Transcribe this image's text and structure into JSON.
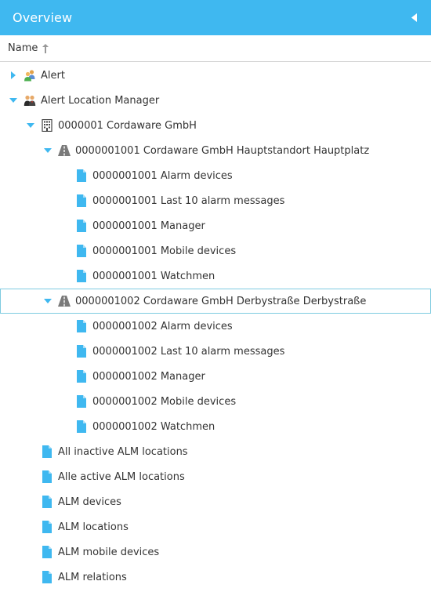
{
  "header": {
    "title": "Overview"
  },
  "columns": {
    "name": "Name"
  },
  "tree": [
    {
      "label": "Alert",
      "level": 0,
      "toggle": "collapsed",
      "icon": "users-icon"
    },
    {
      "label": "Alert Location Manager",
      "level": 0,
      "toggle": "expanded",
      "icon": "users-dark-icon"
    },
    {
      "label": "0000001 Cordaware GmbH",
      "level": 1,
      "toggle": "expanded",
      "icon": "building-icon"
    },
    {
      "label": "0000001001 Cordaware GmbH Hauptstandort Hauptplatz",
      "level": 2,
      "toggle": "expanded",
      "icon": "road-icon"
    },
    {
      "label": "0000001001 Alarm devices",
      "level": 3,
      "toggle": "none",
      "icon": "document-icon"
    },
    {
      "label": "0000001001 Last 10 alarm messages",
      "level": 3,
      "toggle": "none",
      "icon": "document-icon"
    },
    {
      "label": "0000001001 Manager",
      "level": 3,
      "toggle": "none",
      "icon": "document-icon"
    },
    {
      "label": "0000001001 Mobile devices",
      "level": 3,
      "toggle": "none",
      "icon": "document-icon"
    },
    {
      "label": "0000001001 Watchmen",
      "level": 3,
      "toggle": "none",
      "icon": "document-icon"
    },
    {
      "label": "0000001002 Cordaware GmbH Derbystraße Derbystraße",
      "level": 2,
      "toggle": "expanded",
      "icon": "road-icon",
      "selected": true
    },
    {
      "label": "0000001002 Alarm devices",
      "level": 3,
      "toggle": "none",
      "icon": "document-icon"
    },
    {
      "label": "0000001002 Last 10 alarm messages",
      "level": 3,
      "toggle": "none",
      "icon": "document-icon"
    },
    {
      "label": "0000001002 Manager",
      "level": 3,
      "toggle": "none",
      "icon": "document-icon"
    },
    {
      "label": "0000001002 Mobile devices",
      "level": 3,
      "toggle": "none",
      "icon": "document-icon"
    },
    {
      "label": "0000001002 Watchmen",
      "level": 3,
      "toggle": "none",
      "icon": "document-icon"
    },
    {
      "label": "All inactive ALM locations",
      "level": 1,
      "toggle": "none",
      "icon": "document-icon"
    },
    {
      "label": "Alle active ALM locations",
      "level": 1,
      "toggle": "none",
      "icon": "document-icon"
    },
    {
      "label": "ALM devices",
      "level": 1,
      "toggle": "none",
      "icon": "document-icon"
    },
    {
      "label": "ALM locations",
      "level": 1,
      "toggle": "none",
      "icon": "document-icon"
    },
    {
      "label": "ALM mobile devices",
      "level": 1,
      "toggle": "none",
      "icon": "document-icon"
    },
    {
      "label": "ALM relations",
      "level": 1,
      "toggle": "none",
      "icon": "document-icon"
    }
  ],
  "colors": {
    "header_bg": "#3fb8f0",
    "accent": "#3fb8f0",
    "selected_border": "#7ecbe0"
  }
}
